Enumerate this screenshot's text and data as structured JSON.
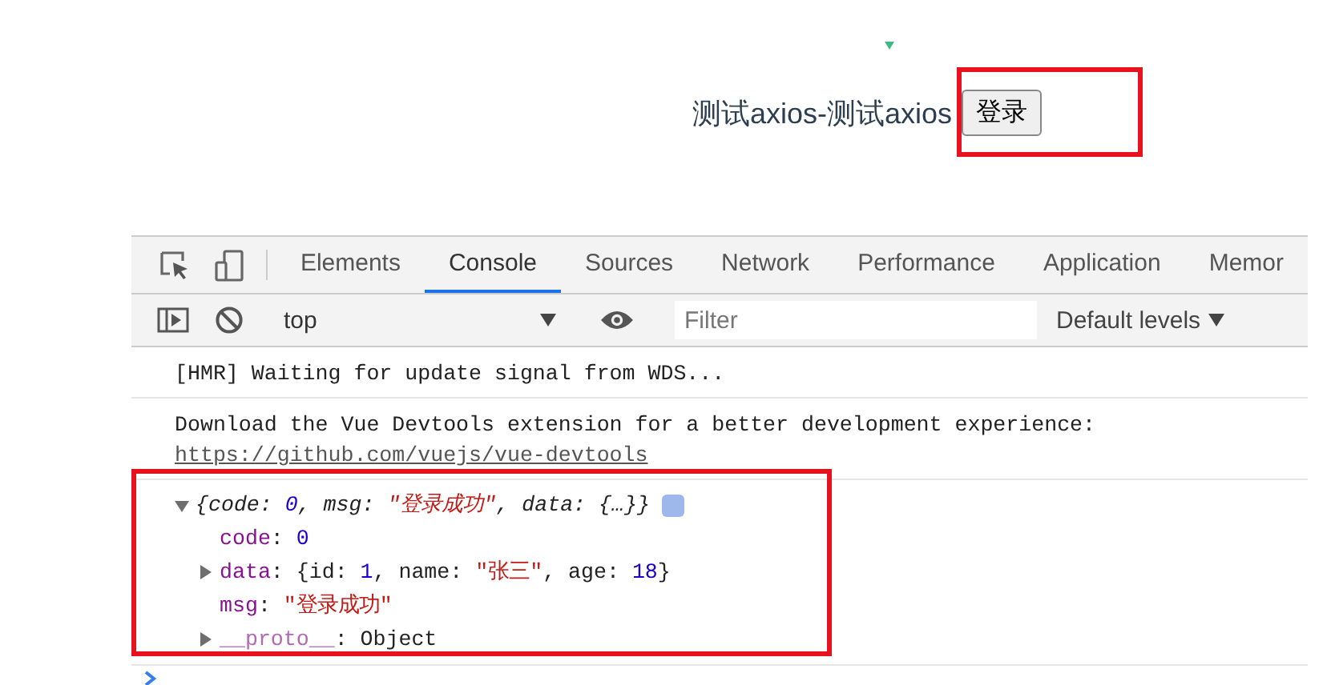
{
  "page": {
    "title": "测试axios-测试axios",
    "login_button": "登录"
  },
  "devtools": {
    "tabs": [
      {
        "label": "Elements",
        "selected": false
      },
      {
        "label": "Console",
        "selected": true
      },
      {
        "label": "Sources",
        "selected": false
      },
      {
        "label": "Network",
        "selected": false
      },
      {
        "label": "Performance",
        "selected": false
      },
      {
        "label": "Application",
        "selected": false
      },
      {
        "label": "Memor",
        "selected": false
      }
    ],
    "context": "top",
    "filter": {
      "placeholder": "Filter"
    },
    "levels": "Default levels",
    "console": [
      {
        "kind": "text",
        "text": "[HMR] Waiting for update signal from WDS..."
      },
      {
        "kind": "text",
        "text": "Download the Vue Devtools extension for a better development experience:",
        "link": "https://github.com/vuejs/vue-devtools"
      },
      {
        "kind": "object",
        "expanded": true,
        "summary": [
          {
            "kind": "plain",
            "text": "{code: "
          },
          {
            "kind": "number",
            "text": "0"
          },
          {
            "kind": "plain",
            "text": ", msg: "
          },
          {
            "kind": "string",
            "text": "\"登录成功\""
          },
          {
            "kind": "plain",
            "text": ", data: {…}}"
          }
        ],
        "properties": [
          {
            "key": "code",
            "expandable": false,
            "dim": false,
            "value": [
              {
                "kind": "plain",
                "text": ": "
              },
              {
                "kind": "number",
                "text": "0"
              }
            ]
          },
          {
            "key": "data",
            "expandable": true,
            "dim": false,
            "value": [
              {
                "kind": "plain",
                "text": ": {id: "
              },
              {
                "kind": "number",
                "text": "1"
              },
              {
                "kind": "plain",
                "text": ", name: "
              },
              {
                "kind": "string",
                "text": "\"张三\""
              },
              {
                "kind": "plain",
                "text": ", age: "
              },
              {
                "kind": "number",
                "text": "18"
              },
              {
                "kind": "plain",
                "text": "}"
              }
            ]
          },
          {
            "key": "msg",
            "expandable": false,
            "dim": false,
            "value": [
              {
                "kind": "plain",
                "text": ": "
              },
              {
                "kind": "string",
                "text": "\"登录成功\""
              }
            ]
          },
          {
            "key": "__proto__",
            "expandable": true,
            "dim": true,
            "value": [
              {
                "kind": "plain",
                "text": ": Object"
              }
            ]
          }
        ]
      }
    ]
  }
}
